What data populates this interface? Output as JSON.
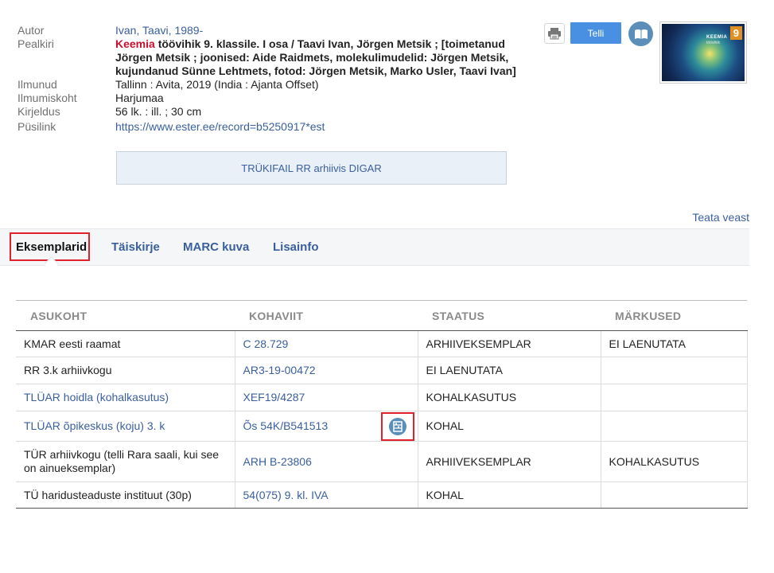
{
  "record": {
    "author_label": "Autor",
    "author": "Ivan, Taavi, 1989-",
    "title_label": "Pealkiri",
    "title_highlight": "Keemia",
    "title_rest": " töövihik 9. klassile. I osa / Taavi Ivan, Jörgen Metsik ; [toimetanud Jörgen Metsik ; joonised: Aide Raidmets, molekulimudelid: Jörgen Metsik, kujundanud Sünne Lehtmets, fotod: Jörgen Metsik, Marko Usler, Taavi Ivan]",
    "published_label": "Ilmunud",
    "published": "Tallinn : Avita, 2019 (India : Ajanta Offset)",
    "place_label": "Ilmumiskoht",
    "place": "Harjumaa",
    "description_label": "Kirjeldus",
    "description": "56 lk. : ill. ; 30 cm",
    "permalink_label": "Püsilink",
    "permalink": "https://www.ester.ee/record=b5250917*est",
    "digar_button": "TRÜKIFAIL RR arhiivis DIGAR"
  },
  "actions": {
    "print_icon": "printer-icon",
    "order_label": "Telli",
    "read_icon": "open-book-icon"
  },
  "cover": {
    "title": "KEEMIA",
    "subtitle": "töövihik",
    "number": "9"
  },
  "report_error": "Teata veast",
  "tabs": [
    {
      "label": "Eksemplarid",
      "active": true
    },
    {
      "label": "Täiskirje",
      "active": false
    },
    {
      "label": "MARC kuva",
      "active": false
    },
    {
      "label": "Lisainfo",
      "active": false
    }
  ],
  "items_table": {
    "headers": [
      "ASUKOHT",
      "KOHAVIIT",
      "STAATUS",
      "MÄRKUSED"
    ],
    "rows": [
      {
        "location": "KMAR eesti raamat",
        "location_link": false,
        "call_number": "C 28.729",
        "status": "ARHIIVEKSEMPLAR",
        "notes": "EI LAENUTATA",
        "shelf_icon": false
      },
      {
        "location": "RR 3.k arhiivkogu",
        "location_link": false,
        "call_number": "AR3-19-00472",
        "status": "EI LAENUTATA",
        "notes": "",
        "shelf_icon": false
      },
      {
        "location": "TLÜAR hoidla (kohalkasutus)",
        "location_link": true,
        "call_number": "XEF19/4287",
        "status": "KOHALKASUTUS",
        "notes": "",
        "shelf_icon": false
      },
      {
        "location": "TLÜAR õpikeskus (koju) 3. k",
        "location_link": true,
        "call_number": "Õs 54K/B541513",
        "status": "KOHAL",
        "notes": "",
        "shelf_icon": true
      },
      {
        "location": "TÜR arhiivkogu (telli Rara saali, kui see on ainueksemplar)",
        "location_link": false,
        "call_number": "ARH B-23806",
        "status": "ARHIIVEKSEMPLAR",
        "notes": "KOHALKASUTUS",
        "shelf_icon": false
      },
      {
        "location": "TÜ haridusteaduste instituut (30p)",
        "location_link": false,
        "call_number": "54(075) 9. kl. IVA",
        "status": "KOHAL",
        "notes": "",
        "shelf_icon": false
      }
    ]
  },
  "colors": {
    "link": "#3a5f9e",
    "highlight_red": "#c8102e",
    "primary_button": "#4a90e2",
    "annotation_red": "#e0202a"
  }
}
